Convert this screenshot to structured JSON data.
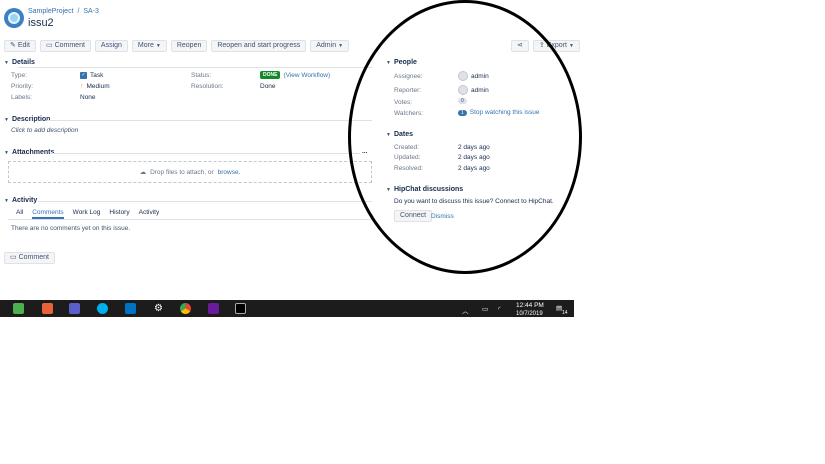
{
  "header": {
    "project": "SampleProject",
    "separator": "/",
    "issue_key": "SA-3",
    "title": "issu2"
  },
  "toolbar": {
    "edit": "Edit",
    "comment": "Comment",
    "assign": "Assign",
    "more": "More",
    "reopen": "Reopen",
    "reopen_start": "Reopen and start progress",
    "admin": "Admin",
    "export": "Export"
  },
  "details": {
    "heading": "Details",
    "type_label": "Type:",
    "type_value": "Task",
    "priority_label": "Priority:",
    "priority_value": "Medium",
    "labels_label": "Labels:",
    "labels_value": "None",
    "status_label": "Status:",
    "status_badge": "DONE",
    "status_link": "(View Workflow)",
    "resolution_label": "Resolution:",
    "resolution_value": "Done"
  },
  "description": {
    "heading": "Description",
    "placeholder": "Click to add description"
  },
  "attachments": {
    "heading": "Attachments",
    "more": "...",
    "drop_text": "Drop files to attach, or",
    "browse": "browse."
  },
  "activity": {
    "heading": "Activity",
    "tabs": [
      "All",
      "Comments",
      "Work Log",
      "History",
      "Activity"
    ],
    "empty": "There are no comments yet on this issue.",
    "comment_button": "Comment"
  },
  "people": {
    "heading": "People",
    "assignee_label": "Assignee:",
    "assignee_value": "admin",
    "reporter_label": "Reporter:",
    "reporter_value": "admin",
    "votes_label": "Votes:",
    "votes_value": "0",
    "watchers_label": "Watchers:",
    "watchers_count": "1",
    "watchers_link": "Stop watching this issue"
  },
  "dates": {
    "heading": "Dates",
    "created_label": "Created:",
    "created_value": "2 days ago",
    "updated_label": "Updated:",
    "updated_value": "2 days ago",
    "resolved_label": "Resolved:",
    "resolved_value": "2 days ago"
  },
  "hipchat": {
    "heading": "HipChat discussions",
    "text": "Do you want to discuss this issue? Connect to HipChat.",
    "connect": "Connect",
    "dismiss": "Dismiss"
  },
  "taskbar": {
    "time": "12:44 PM",
    "date": "10/7/2019",
    "notification_count": "14"
  },
  "colors": {
    "link": "#3572b0",
    "done": "#14892c",
    "taskbar": "#1c1c1c"
  }
}
